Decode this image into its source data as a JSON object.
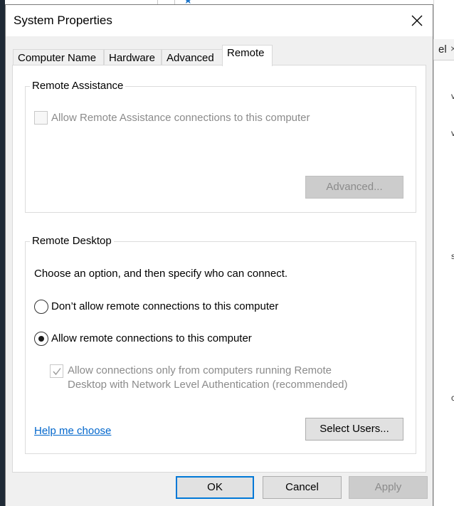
{
  "background": {
    "tab_text": "el",
    "tab_close": "×",
    "glyphs": [
      "v",
      "v",
      "s",
      "c"
    ]
  },
  "window": {
    "title": "System Properties"
  },
  "tabs": [
    {
      "label": "Computer Name"
    },
    {
      "label": "Hardware"
    },
    {
      "label": "Advanced"
    },
    {
      "label": "Remote",
      "active": true
    }
  ],
  "remote_assistance": {
    "title": "Remote Assistance",
    "allow_checkbox_label": "Allow Remote Assistance connections to this computer",
    "allow_checked": false,
    "advanced_button": "Advanced..."
  },
  "remote_desktop": {
    "title": "Remote Desktop",
    "instruction": "Choose an option, and then specify who can connect.",
    "option_dont_allow": "Don’t allow remote connections to this computer",
    "option_allow": "Allow remote connections to this computer",
    "selected_option": "allow",
    "nla_label_line1": "Allow connections only from computers running Remote",
    "nla_label_line2": "Desktop with Network Level Authentication (recommended)",
    "nla_checked": true,
    "help_link": "Help me choose",
    "select_users_button": "Select Users..."
  },
  "footer": {
    "ok": "OK",
    "cancel": "Cancel",
    "apply": "Apply"
  },
  "colors": {
    "accent": "#0078d7",
    "link": "#0066cc",
    "disabled_text": "#8b8b8b",
    "dialog_bg": "#f0f0f0"
  }
}
